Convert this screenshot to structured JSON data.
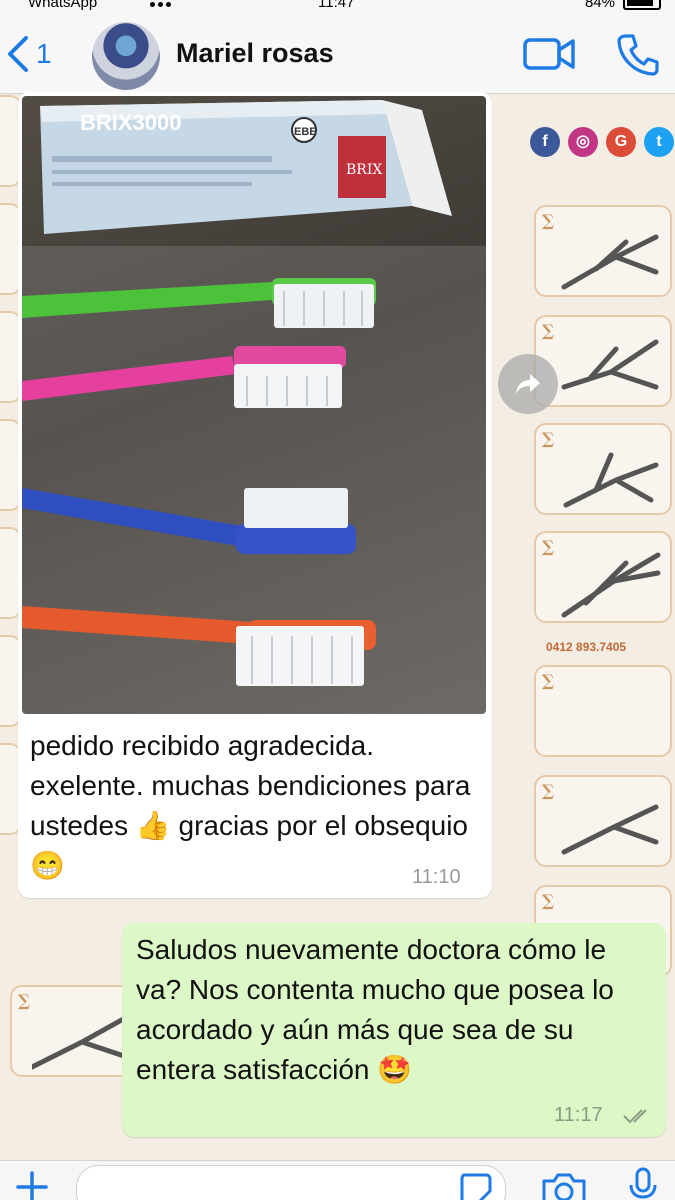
{
  "status_bar": {
    "carrier": "WhatsApp",
    "time": "11:47",
    "battery": "84%"
  },
  "header": {
    "back_count": "1",
    "contact_name": "Mariel rosas"
  },
  "wallpaper": {
    "phone": "0412 893.7405"
  },
  "messages": [
    {
      "direction": "incoming",
      "has_image": true,
      "image_caption_text": "pedido recibido agradecida. exelente. muchas bendiciones para ustedes 👍 gracias por el obsequio 😁",
      "time": "11:10"
    },
    {
      "direction": "outgoing",
      "text": "Saludos nuevamente doctora cómo le va? Nos contenta mucho que posea lo acordado y aún más que sea de su entera satisfacción 🤩",
      "time": "11:17",
      "status": "read"
    }
  ],
  "photo_product": {
    "brand": "BRIX3000",
    "badge": "EBE",
    "side_label": "BRIX",
    "toothbrushes": [
      "green",
      "pink",
      "blue",
      "orange"
    ]
  },
  "colors": {
    "accent": "#1e7be6",
    "outgoing_bubble": "#dcf8c6",
    "incoming_bubble": "#ffffff"
  },
  "icons": {
    "back": "chevron-left-icon",
    "video": "video-camera-icon",
    "call": "phone-icon",
    "forward": "forward-icon",
    "plus": "plus-icon",
    "sticker": "sticker-icon",
    "camera": "camera-icon",
    "mic": "microphone-icon"
  }
}
